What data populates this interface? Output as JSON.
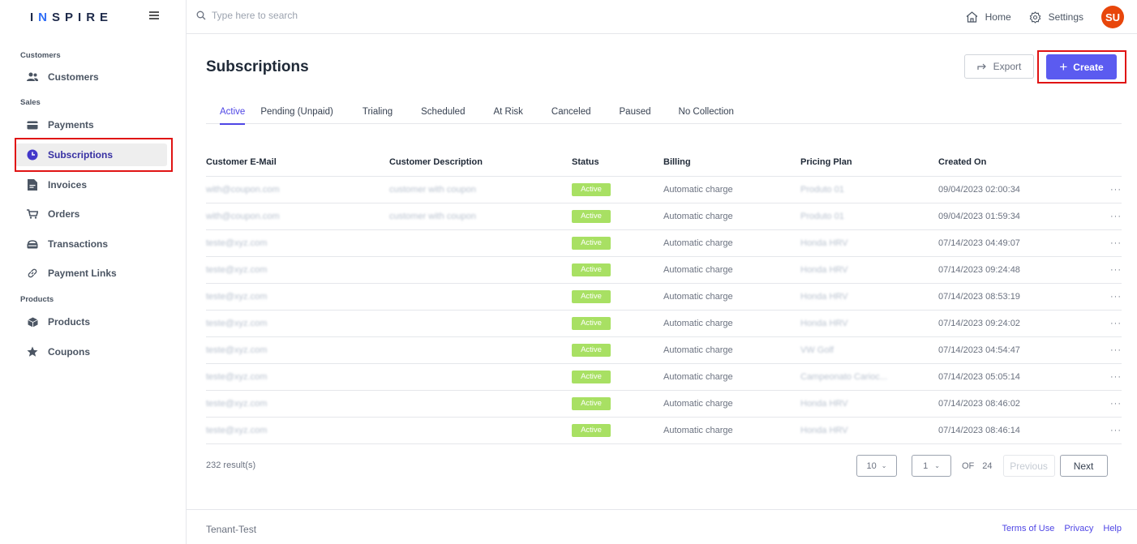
{
  "brand": {
    "letters": "I",
    "n": "N",
    "rest": "SPIRE"
  },
  "search": {
    "placeholder": "Type here to search"
  },
  "top": {
    "home": "Home",
    "settings": "Settings",
    "avatar": "SU"
  },
  "sidebar": {
    "section_customers": "Customers",
    "section_sales": "Sales",
    "section_products": "Products",
    "items": [
      {
        "label": "Customers",
        "icon": "users-icon"
      },
      {
        "label": "Payments",
        "icon": "credit-card-icon"
      },
      {
        "label": "Subscriptions",
        "icon": "clock-icon"
      },
      {
        "label": "Invoices",
        "icon": "document-icon"
      },
      {
        "label": "Orders",
        "icon": "cart-icon"
      },
      {
        "label": "Transactions",
        "icon": "wallet-icon"
      },
      {
        "label": "Payment Links",
        "icon": "link-icon"
      },
      {
        "label": "Products",
        "icon": "box-icon"
      },
      {
        "label": "Coupons",
        "icon": "star-icon"
      }
    ]
  },
  "page": {
    "title": "Subscriptions",
    "export": "Export",
    "create": "Create"
  },
  "tabs": [
    "Active",
    "Pending (Unpaid)",
    "Trialing",
    "Scheduled",
    "At Risk",
    "Canceled",
    "Paused",
    "No Collection"
  ],
  "table": {
    "headers": [
      "Customer E-Mail",
      "Customer Description",
      "Status",
      "Billing",
      "Pricing Plan",
      "Created On"
    ],
    "rows": [
      {
        "email": "with@coupon.com",
        "desc": "customer with coupon",
        "status": "Active",
        "billing": "Automatic charge",
        "plan": "Produto 01",
        "created": "09/04/2023 02:00:34"
      },
      {
        "email": "with@coupon.com",
        "desc": "customer with coupon",
        "status": "Active",
        "billing": "Automatic charge",
        "plan": "Produto 01",
        "created": "09/04/2023 01:59:34"
      },
      {
        "email": "teste@xyz.com",
        "desc": "",
        "status": "Active",
        "billing": "Automatic charge",
        "plan": "Honda HRV",
        "created": "07/14/2023 04:49:07"
      },
      {
        "email": "teste@xyz.com",
        "desc": "",
        "status": "Active",
        "billing": "Automatic charge",
        "plan": "Honda HRV",
        "created": "07/14/2023 09:24:48"
      },
      {
        "email": "teste@xyz.com",
        "desc": "",
        "status": "Active",
        "billing": "Automatic charge",
        "plan": "Honda HRV",
        "created": "07/14/2023 08:53:19"
      },
      {
        "email": "teste@xyz.com",
        "desc": "",
        "status": "Active",
        "billing": "Automatic charge",
        "plan": "Honda HRV",
        "created": "07/14/2023 09:24:02"
      },
      {
        "email": "teste@xyz.com",
        "desc": "",
        "status": "Active",
        "billing": "Automatic charge",
        "plan": "VW Golf",
        "created": "07/14/2023 04:54:47"
      },
      {
        "email": "teste@xyz.com",
        "desc": "",
        "status": "Active",
        "billing": "Automatic charge",
        "plan": "Campeonato Carioc...",
        "created": "07/14/2023 05:05:14"
      },
      {
        "email": "teste@xyz.com",
        "desc": "",
        "status": "Active",
        "billing": "Automatic charge",
        "plan": "Honda HRV",
        "created": "07/14/2023 08:46:02"
      },
      {
        "email": "teste@xyz.com",
        "desc": "",
        "status": "Active",
        "billing": "Automatic charge",
        "plan": "Honda HRV",
        "created": "07/14/2023 08:46:14"
      }
    ],
    "row_menu": "···"
  },
  "pagination": {
    "results": "232 result(s)",
    "page_size": "10",
    "page": "1",
    "of_label": "OF",
    "total_pages": "24",
    "previous": "Previous",
    "next": "Next"
  },
  "footer": {
    "tenant": "Tenant-Test",
    "links": [
      "Terms of Use",
      "Privacy",
      "Help"
    ]
  },
  "colors": {
    "accent": "#5b5bf0",
    "highlight": "#e01414",
    "active_badge": "#a8e063",
    "avatar": "#e8460b"
  }
}
